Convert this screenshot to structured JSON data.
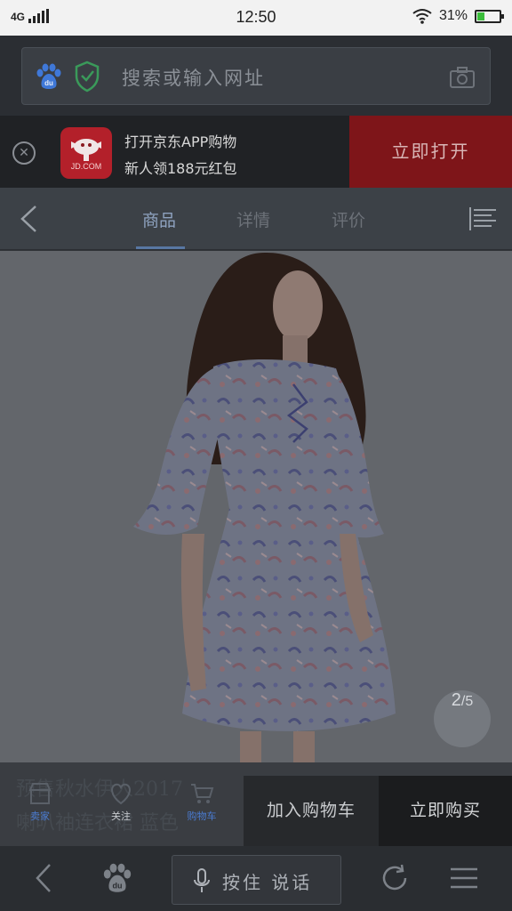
{
  "status_bar": {
    "network": "4G",
    "time": "12:50",
    "battery_percent": "31%",
    "battery_level": 0.31
  },
  "address_bar": {
    "placeholder": "搜索或输入网址"
  },
  "banner": {
    "line1": "打开京东APP购物",
    "line2": "新人领188元红包",
    "logo_text": "JD.COM",
    "open_button": "立即打开"
  },
  "tabs": [
    {
      "label": "商品",
      "active": true
    },
    {
      "label": "详情",
      "active": false
    },
    {
      "label": "评价",
      "active": false
    }
  ],
  "gallery": {
    "current": "2",
    "total": "/5"
  },
  "product": {
    "title_line1": "预售秋水伊人2017",
    "title_line2": "喇叭袖连衣裙 蓝色"
  },
  "actions": {
    "shop_label": "卖家",
    "follow_label": "关注",
    "cart_label": "购物车",
    "add_to_cart": "加入购物车",
    "buy_now": "立即购买"
  },
  "browser_nav": {
    "voice_label": "按住 说话"
  },
  "colors": {
    "jd_red": "#b3202a",
    "open_button": "#7e1519",
    "active_tab": "#8ea2bf",
    "link_blue": "#4a7bd1"
  }
}
